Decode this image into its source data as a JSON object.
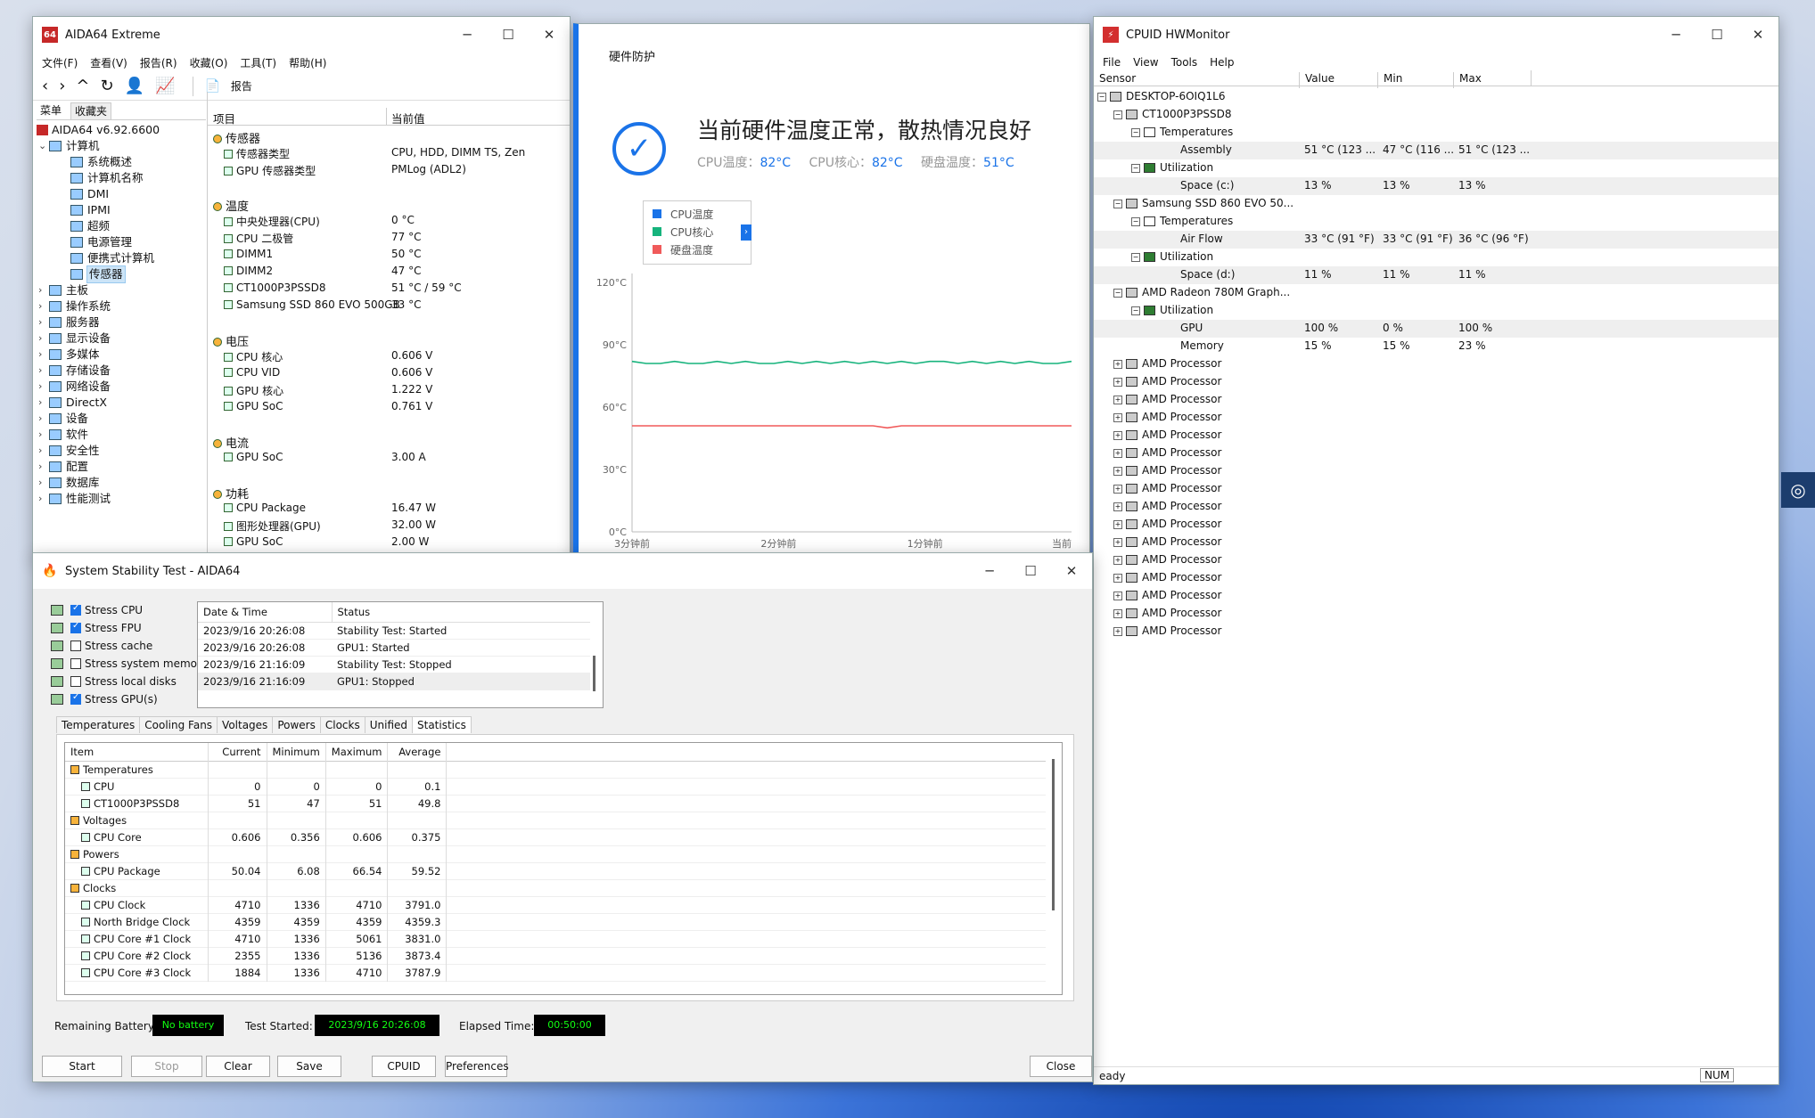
{
  "aida": {
    "title": "AIDA64 Extreme",
    "menu": [
      "文件(F)",
      "查看(V)",
      "报告(R)",
      "收藏(O)",
      "工具(T)",
      "帮助(H)"
    ],
    "report": "报告",
    "tabs": [
      "菜单",
      "收藏夹"
    ],
    "version": "AIDA64 v6.92.6600",
    "tree": [
      {
        "label": "计算机",
        "lvl": 0,
        "exp": "⌄"
      },
      {
        "label": "系统概述",
        "lvl": 1
      },
      {
        "label": "计算机名称",
        "lvl": 1
      },
      {
        "label": "DMI",
        "lvl": 1
      },
      {
        "label": "IPMI",
        "lvl": 1
      },
      {
        "label": "超频",
        "lvl": 1
      },
      {
        "label": "电源管理",
        "lvl": 1
      },
      {
        "label": "便携式计算机",
        "lvl": 1
      },
      {
        "label": "传感器",
        "lvl": 1,
        "sel": true
      },
      {
        "label": "主板",
        "lvl": 0,
        "exp": "›"
      },
      {
        "label": "操作系统",
        "lvl": 0,
        "exp": "›"
      },
      {
        "label": "服务器",
        "lvl": 0,
        "exp": "›"
      },
      {
        "label": "显示设备",
        "lvl": 0,
        "exp": "›"
      },
      {
        "label": "多媒体",
        "lvl": 0,
        "exp": "›"
      },
      {
        "label": "存储设备",
        "lvl": 0,
        "exp": "›"
      },
      {
        "label": "网络设备",
        "lvl": 0,
        "exp": "›"
      },
      {
        "label": "DirectX",
        "lvl": 0,
        "exp": "›"
      },
      {
        "label": "设备",
        "lvl": 0,
        "exp": "›"
      },
      {
        "label": "软件",
        "lvl": 0,
        "exp": "›"
      },
      {
        "label": "安全性",
        "lvl": 0,
        "exp": "›"
      },
      {
        "label": "配置",
        "lvl": 0,
        "exp": "›"
      },
      {
        "label": "数据库",
        "lvl": 0,
        "exp": "›"
      },
      {
        "label": "性能测试",
        "lvl": 0,
        "exp": "›"
      }
    ],
    "col_item": "项目",
    "col_value": "当前值",
    "sensors": [
      {
        "y": 0,
        "label": "传感器",
        "hdr": true
      },
      {
        "y": 19,
        "label": "传感器类型",
        "value": "CPU, HDD, DIMM TS, Zen"
      },
      {
        "y": 38,
        "label": "GPU 传感器类型",
        "value": "PMLog  (ADL2)"
      },
      {
        "y": 76,
        "label": "温度",
        "hdr": true
      },
      {
        "y": 95,
        "label": "中央处理器(CPU)",
        "value": "0 °C"
      },
      {
        "y": 114,
        "label": "CPU 二极管",
        "value": "77 °C"
      },
      {
        "y": 133,
        "label": "DIMM1",
        "value": "50 °C"
      },
      {
        "y": 152,
        "label": "DIMM2",
        "value": "47 °C"
      },
      {
        "y": 171,
        "label": "CT1000P3PSSD8",
        "value": "51 °C / 59 °C"
      },
      {
        "y": 190,
        "label": "Samsung SSD 860 EVO 500GB",
        "value": "33 °C"
      },
      {
        "y": 228,
        "label": "电压",
        "hdr": true
      },
      {
        "y": 247,
        "label": "CPU 核心",
        "value": "0.606 V"
      },
      {
        "y": 266,
        "label": "CPU VID",
        "value": "0.606 V"
      },
      {
        "y": 285,
        "label": "GPU 核心",
        "value": "1.222 V"
      },
      {
        "y": 304,
        "label": "GPU SoC",
        "value": "0.761 V"
      },
      {
        "y": 342,
        "label": "电流",
        "hdr": true
      },
      {
        "y": 361,
        "label": "GPU SoC",
        "value": "3.00 A"
      },
      {
        "y": 399,
        "label": "功耗",
        "hdr": true
      },
      {
        "y": 418,
        "label": "CPU Package",
        "value": "16.47 W"
      },
      {
        "y": 437,
        "label": "图形处理器(GPU)",
        "value": "32.00 W"
      },
      {
        "y": 456,
        "label": "GPU SoC",
        "value": "2.00 W"
      }
    ]
  },
  "guard": {
    "title": "硬件防护",
    "status": "当前硬件温度正常，散热情况良好",
    "cpu_temp_label": "CPU温度：",
    "cpu_temp": "82°C",
    "cpu_core_label": "CPU核心：",
    "cpu_core": "82°C",
    "disk_label": "硬盘温度：",
    "disk": "51°C",
    "legend": [
      {
        "name": "CPU温度",
        "color": "#1a73e8"
      },
      {
        "name": "CPU核心",
        "color": "#16b37c"
      },
      {
        "name": "硬盘温度",
        "color": "#f05a5a"
      }
    ]
  },
  "chart_data": {
    "type": "line",
    "y_ticks": [
      "120°C",
      "90°C",
      "60°C",
      "30°C",
      "0°C"
    ],
    "ylim": [
      0,
      120
    ],
    "x_ticks": [
      "3分钟前",
      "2分钟前",
      "1分钟前",
      "当前"
    ],
    "series": [
      {
        "name": "CPU核心",
        "color": "#16b37c",
        "values": [
          82,
          81,
          81,
          82,
          81,
          81,
          82,
          81,
          82,
          81,
          81,
          82,
          81,
          82,
          81,
          82,
          81,
          82,
          81,
          82,
          81,
          82,
          82,
          81,
          82,
          81,
          82,
          81,
          82,
          81,
          81,
          82
        ]
      },
      {
        "name": "硬盘温度",
        "color": "#f05a5a",
        "values": [
          51,
          51,
          51,
          51,
          51,
          51,
          51,
          51,
          51,
          51,
          51,
          51,
          51,
          51,
          51,
          51,
          51,
          51,
          50,
          51,
          51,
          51,
          51,
          51,
          51,
          51,
          51,
          51,
          51,
          51,
          51,
          51
        ]
      }
    ]
  },
  "hwm": {
    "title": "CPUID HWMonitor",
    "menu": [
      "File",
      "View",
      "Tools",
      "Help"
    ],
    "cols": [
      "Sensor",
      "Value",
      "Min",
      "Max"
    ],
    "rows": [
      {
        "l": 0,
        "t": "DESKTOP-6OIQ1L6"
      },
      {
        "l": 1,
        "t": "CT1000P3PSSD8"
      },
      {
        "l": 2,
        "t": "Temperatures"
      },
      {
        "l": 4,
        "t": "Assembly",
        "v": "51 °C  (123 ...",
        "mn": "47 °C  (116 ...",
        "mx": "51 °C  (123 ...",
        "sh": true
      },
      {
        "l": 2,
        "t": "Utilization"
      },
      {
        "l": 4,
        "t": "Space (c:)",
        "v": "13 %",
        "mn": "13 %",
        "mx": "13 %",
        "sh": true
      },
      {
        "l": 1,
        "t": "Samsung SSD 860 EVO 50..."
      },
      {
        "l": 2,
        "t": "Temperatures"
      },
      {
        "l": 4,
        "t": "Air Flow",
        "v": "33 °C  (91 °F)",
        "mn": "33 °C  (91 °F)",
        "mx": "36 °C  (96 °F)",
        "sh": true
      },
      {
        "l": 2,
        "t": "Utilization"
      },
      {
        "l": 4,
        "t": "Space (d:)",
        "v": "11 %",
        "mn": "11 %",
        "mx": "11 %",
        "sh": true
      },
      {
        "l": 1,
        "t": "AMD Radeon 780M Graph..."
      },
      {
        "l": 2,
        "t": "Utilization"
      },
      {
        "l": 4,
        "t": "GPU",
        "v": "100 %",
        "mn": "0 %",
        "mx": "100 %",
        "sh": true
      },
      {
        "l": 4,
        "t": "Memory",
        "v": "15 %",
        "mn": "15 %",
        "mx": "23 %"
      },
      {
        "l": 1,
        "t": "AMD Processor"
      },
      {
        "l": 1,
        "t": "AMD Processor"
      },
      {
        "l": 1,
        "t": "AMD Processor"
      },
      {
        "l": 1,
        "t": "AMD Processor"
      },
      {
        "l": 1,
        "t": "AMD Processor"
      },
      {
        "l": 1,
        "t": "AMD Processor"
      },
      {
        "l": 1,
        "t": "AMD Processor"
      },
      {
        "l": 1,
        "t": "AMD Processor"
      },
      {
        "l": 1,
        "t": "AMD Processor"
      },
      {
        "l": 1,
        "t": "AMD Processor"
      },
      {
        "l": 1,
        "t": "AMD Processor"
      },
      {
        "l": 1,
        "t": "AMD Processor"
      },
      {
        "l": 1,
        "t": "AMD Processor"
      },
      {
        "l": 1,
        "t": "AMD Processor"
      },
      {
        "l": 1,
        "t": "AMD Processor"
      },
      {
        "l": 1,
        "t": "AMD Processor"
      }
    ],
    "status": "eady",
    "num": "NUM"
  },
  "sst": {
    "title": "System Stability Test - AIDA64",
    "checks": [
      {
        "label": "Stress CPU",
        "on": true
      },
      {
        "label": "Stress FPU",
        "on": true
      },
      {
        "label": "Stress cache",
        "on": false
      },
      {
        "label": "Stress system memory",
        "on": false
      },
      {
        "label": "Stress local disks",
        "on": false
      },
      {
        "label": "Stress GPU(s)",
        "on": true
      }
    ],
    "log_cols": [
      "Date & Time",
      "Status"
    ],
    "log": [
      {
        "d": "2023/9/16 20:26:08",
        "s": "Stability Test: Started"
      },
      {
        "d": "2023/9/16 20:26:08",
        "s": "GPU1: Started"
      },
      {
        "d": "2023/9/16 21:16:09",
        "s": "Stability Test: Stopped"
      },
      {
        "d": "2023/9/16 21:16:09",
        "s": "GPU1: Stopped"
      }
    ],
    "tabs": [
      "Temperatures",
      "Cooling Fans",
      "Voltages",
      "Powers",
      "Clocks",
      "Unified",
      "Statistics"
    ],
    "stat_cols": [
      "Item",
      "Current",
      "Minimum",
      "Maximum",
      "Average"
    ],
    "stats": [
      {
        "g": true,
        "i": "Temperatures"
      },
      {
        "i": "CPU",
        "c": "0",
        "mn": "0",
        "mx": "0",
        "a": "0.1"
      },
      {
        "i": "CT1000P3PSSD8",
        "c": "51",
        "mn": "47",
        "mx": "51",
        "a": "49.8"
      },
      {
        "g": true,
        "i": "Voltages"
      },
      {
        "i": "CPU Core",
        "c": "0.606",
        "mn": "0.356",
        "mx": "0.606",
        "a": "0.375"
      },
      {
        "g": true,
        "i": "Powers"
      },
      {
        "i": "CPU Package",
        "c": "50.04",
        "mn": "6.08",
        "mx": "66.54",
        "a": "59.52"
      },
      {
        "g": true,
        "i": "Clocks"
      },
      {
        "i": "CPU Clock",
        "c": "4710",
        "mn": "1336",
        "mx": "4710",
        "a": "3791.0"
      },
      {
        "i": "North Bridge Clock",
        "c": "4359",
        "mn": "4359",
        "mx": "4359",
        "a": "4359.3"
      },
      {
        "i": "CPU Core #1 Clock",
        "c": "4710",
        "mn": "1336",
        "mx": "5061",
        "a": "3831.0"
      },
      {
        "i": "CPU Core #2 Clock",
        "c": "2355",
        "mn": "1336",
        "mx": "5136",
        "a": "3873.4"
      },
      {
        "i": "CPU Core #3 Clock",
        "c": "1884",
        "mn": "1336",
        "mx": "4710",
        "a": "3787.9"
      }
    ],
    "battery_label": "Remaining Battery:",
    "battery": "No battery",
    "started_label": "Test Started:",
    "started": "2023/9/16 20:26:08",
    "elapsed_label": "Elapsed Time:",
    "elapsed": "00:50:00",
    "buttons": {
      "start": "Start",
      "stop": "Stop",
      "clear": "Clear",
      "save": "Save",
      "cpuid": "CPUID",
      "prefs": "Preferences",
      "close": "Close"
    }
  }
}
